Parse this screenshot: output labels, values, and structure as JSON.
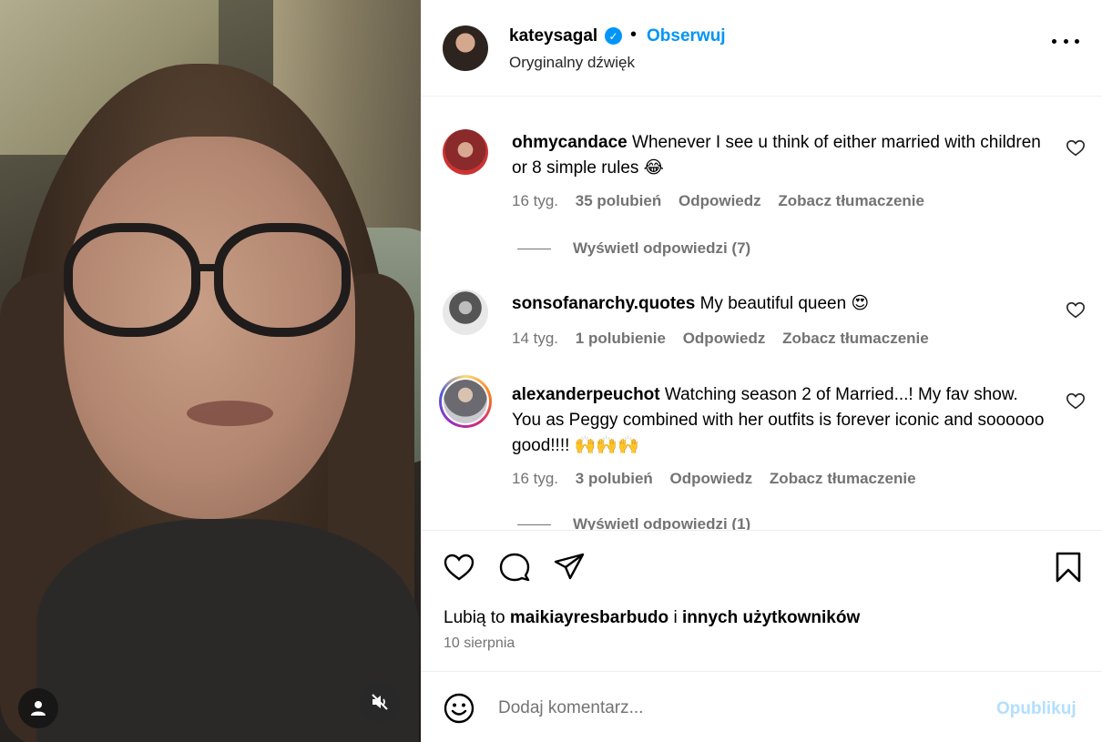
{
  "post": {
    "author": "kateysagal",
    "follow_label": "Obserwuj",
    "separator": "•",
    "audio_label": "Oryginalny dźwięk",
    "verified_mark": "✓"
  },
  "comments": [
    {
      "username": "ohmycandace",
      "text": "Whenever I see u think of either married with children or 8 simple rules 😂",
      "time": "16 tyg.",
      "likes": "35 polubień",
      "reply": "Odpowiedz",
      "translate": "Zobacz tłumaczenie",
      "view_replies": "Wyświetl odpowiedzi (7)"
    },
    {
      "username": "sonsofanarchy.quotes",
      "text": "My beautiful queen 😍",
      "time": "14 tyg.",
      "likes": "1 polubienie",
      "reply": "Odpowiedz",
      "translate": "Zobacz tłumaczenie"
    },
    {
      "username": "alexanderpeuchot",
      "text": "Watching season 2 of Married...! My fav show. You as Peggy combined with her outfits is forever iconic and soooooo good!!!! 🙌🙌🙌",
      "time": "16 tyg.",
      "likes": "3 polubień",
      "reply": "Odpowiedz",
      "translate": "Zobacz tłumaczenie",
      "view_replies": "Wyświetl odpowiedzi (1)"
    }
  ],
  "likes_line": {
    "prefix": "Lubią to",
    "user": "maikiayresbarbudo",
    "joiner": "i",
    "others": "innych użytkowników"
  },
  "date": "10 sierpnia",
  "add_comment": {
    "placeholder": "Dodaj komentarz...",
    "publish_label": "Opublikuj"
  },
  "colors": {
    "accent": "#0095f6",
    "muted": "#737373",
    "publish_disabled": "#b2dffc",
    "divider": "#efefef"
  },
  "icons": [
    "user-icon",
    "muted-audio-icon",
    "verified-icon",
    "more-options-icon",
    "heart-icon",
    "comment-icon",
    "share-icon",
    "bookmark-icon",
    "emoji-icon"
  ]
}
